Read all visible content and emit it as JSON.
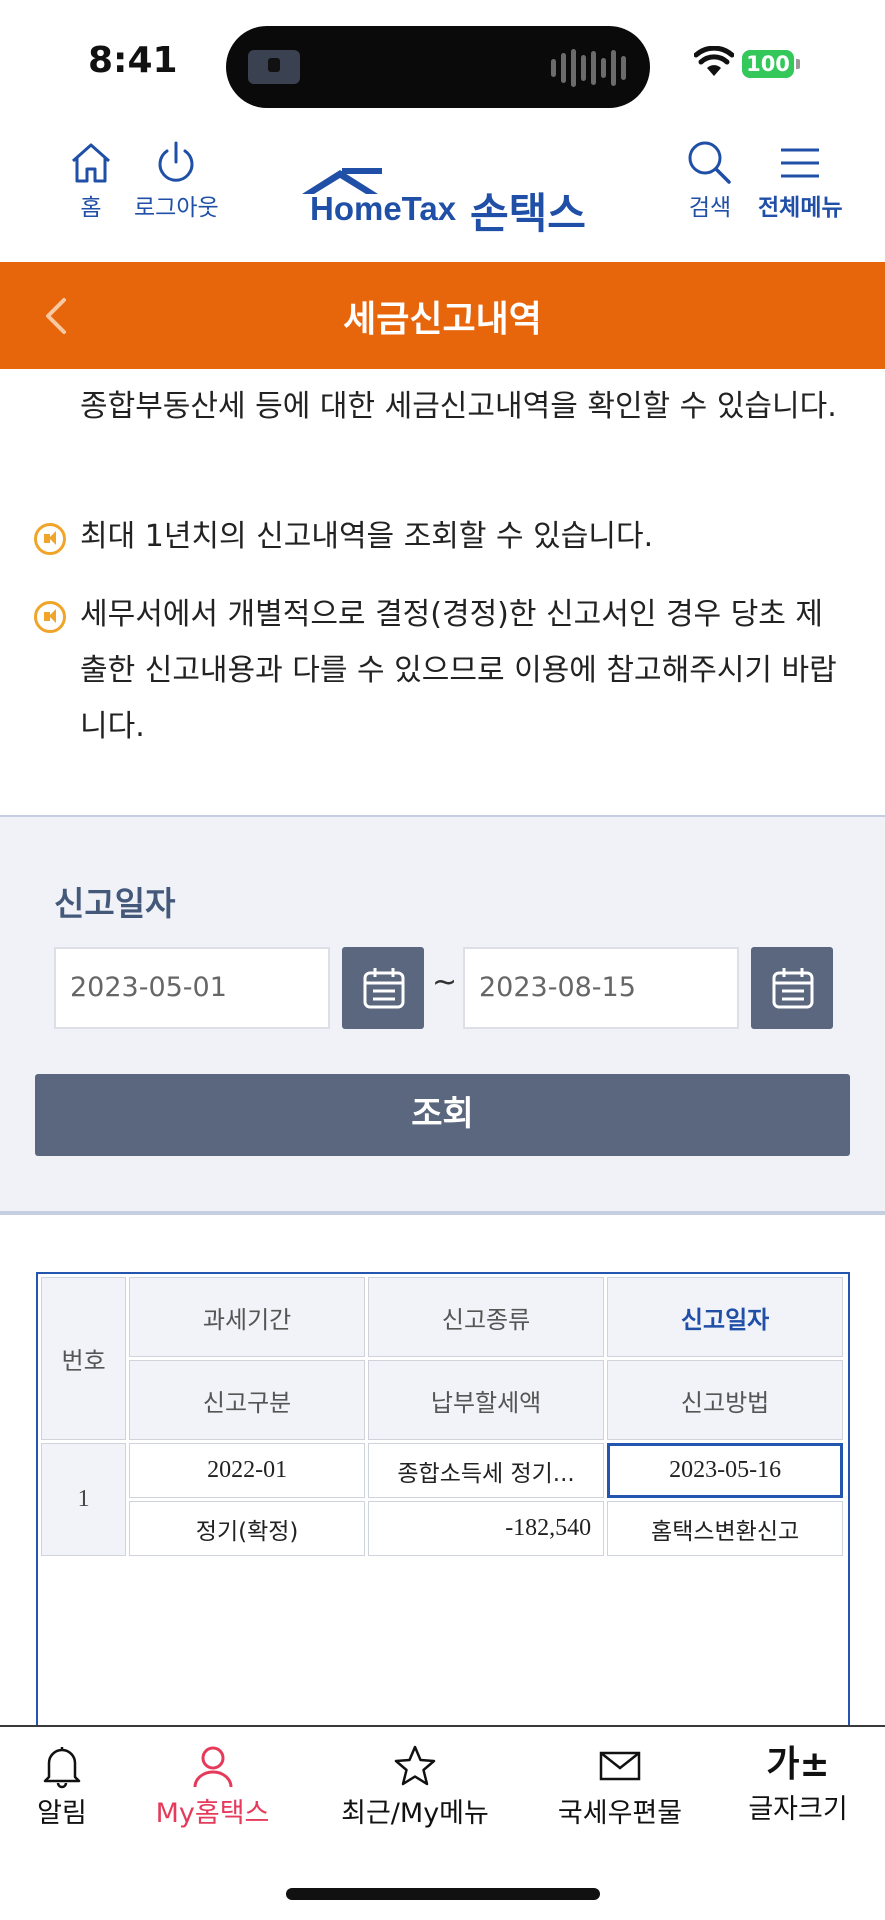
{
  "status_bar": {
    "time": "8:41",
    "battery": "100"
  },
  "header": {
    "home_label": "홈",
    "logout_label": "로그아웃",
    "logo_hometax": "HomeTax",
    "logo_sontax": "손택스",
    "search_label": "검색",
    "menu_label": "전체메뉴"
  },
  "page": {
    "title": "세금신고내역"
  },
  "notices": [
    {
      "text": "종합부동산세 등에 대한 세금신고내역을 확인할 수 있습니다."
    },
    {
      "text": "최대 1년치의 신고내역을 조회할 수 있습니다."
    },
    {
      "text": "세무서에서 개별적으로 결정(경정)한 신고서인 경우 당초 제출한 신고내용과 다를 수 있으므로 이용에 참고해주시기 바랍니다."
    }
  ],
  "search": {
    "label": "신고일자",
    "from_date": "2023-05-01",
    "to_date": "2023-08-15",
    "separator": "~",
    "submit_label": "조회"
  },
  "table": {
    "headers": {
      "number": "번호",
      "tax_period": "과세기간",
      "report_type": "신고종류",
      "report_date": "신고일자",
      "report_category": "신고구분",
      "tax_due": "납부할세액",
      "report_method": "신고방법"
    },
    "rows": [
      {
        "number": "1",
        "tax_period": "2022-01",
        "report_type": "종합소득세 정기...",
        "report_date": "2023-05-16",
        "report_category": "정기(확정)",
        "tax_due": "-182,540",
        "report_method": "홈택스변환신고"
      }
    ]
  },
  "bottom_nav": {
    "alerts": "알림",
    "my_hometax": "My홈택스",
    "recent_menu": "최근/My메뉴",
    "mail": "국세우편물",
    "font_size": "글자크기",
    "font_size_glyph": "가±"
  },
  "colors": {
    "brand_blue": "#1f4fa6",
    "title_orange": "#e8660b",
    "button_slate": "#5b677e",
    "active_pink": "#e63a5b",
    "notice_icon": "#f0a52a"
  }
}
